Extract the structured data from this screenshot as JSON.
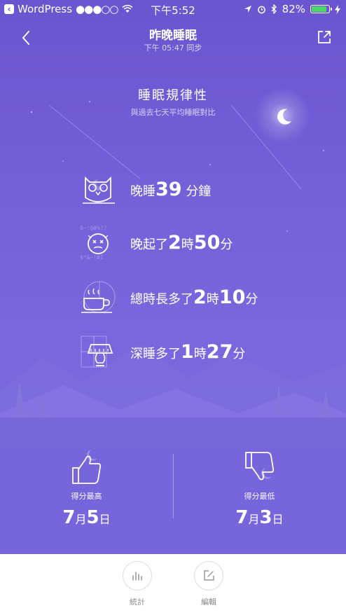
{
  "status_bar": {
    "app": "WordPress",
    "signal": "●●●○○",
    "time": "下午5:52",
    "battery": "82%",
    "battery_level": 0.82
  },
  "header": {
    "title": "昨晚睡眠",
    "subtitle": "下午 05:47 同步"
  },
  "section": {
    "title": "睡眠規律性",
    "subtitle": "與過去七天平均睡眠對比"
  },
  "metrics": [
    {
      "icon": "owl-icon",
      "prefix": "晚睡",
      "v1": "39",
      "u1": "分鐘",
      "v2": "",
      "u2": ""
    },
    {
      "icon": "sleepy-face-icon",
      "prefix": "晚起了",
      "v1": "2",
      "u1": "時",
      "v2": "50",
      "u2": "分"
    },
    {
      "icon": "coffee-cup-icon",
      "prefix": "總時長多了",
      "v1": "2",
      "u1": "時",
      "v2": "10",
      "u2": "分"
    },
    {
      "icon": "lamp-icon",
      "prefix": "深睡多了",
      "v1": "1",
      "u1": "時",
      "v2": "27",
      "u2": "分"
    }
  ],
  "stats": {
    "best": {
      "icon": "thumbs-up-icon",
      "label": "得分最高",
      "month": "7",
      "month_unit": "月",
      "day": "5",
      "day_unit": "日"
    },
    "worst": {
      "icon": "thumbs-down-icon",
      "label": "得分最低",
      "month": "7",
      "month_unit": "月",
      "day": "3",
      "day_unit": "日"
    }
  },
  "tabs": [
    {
      "icon": "bar-chart-icon",
      "label": "統計"
    },
    {
      "icon": "edit-icon",
      "label": "編輯"
    }
  ],
  "colors": {
    "background_top": "#6a55d0",
    "background_bottom": "#7b69df",
    "battery_fill": "#4cd964",
    "tab_bar": "#ffffff"
  }
}
